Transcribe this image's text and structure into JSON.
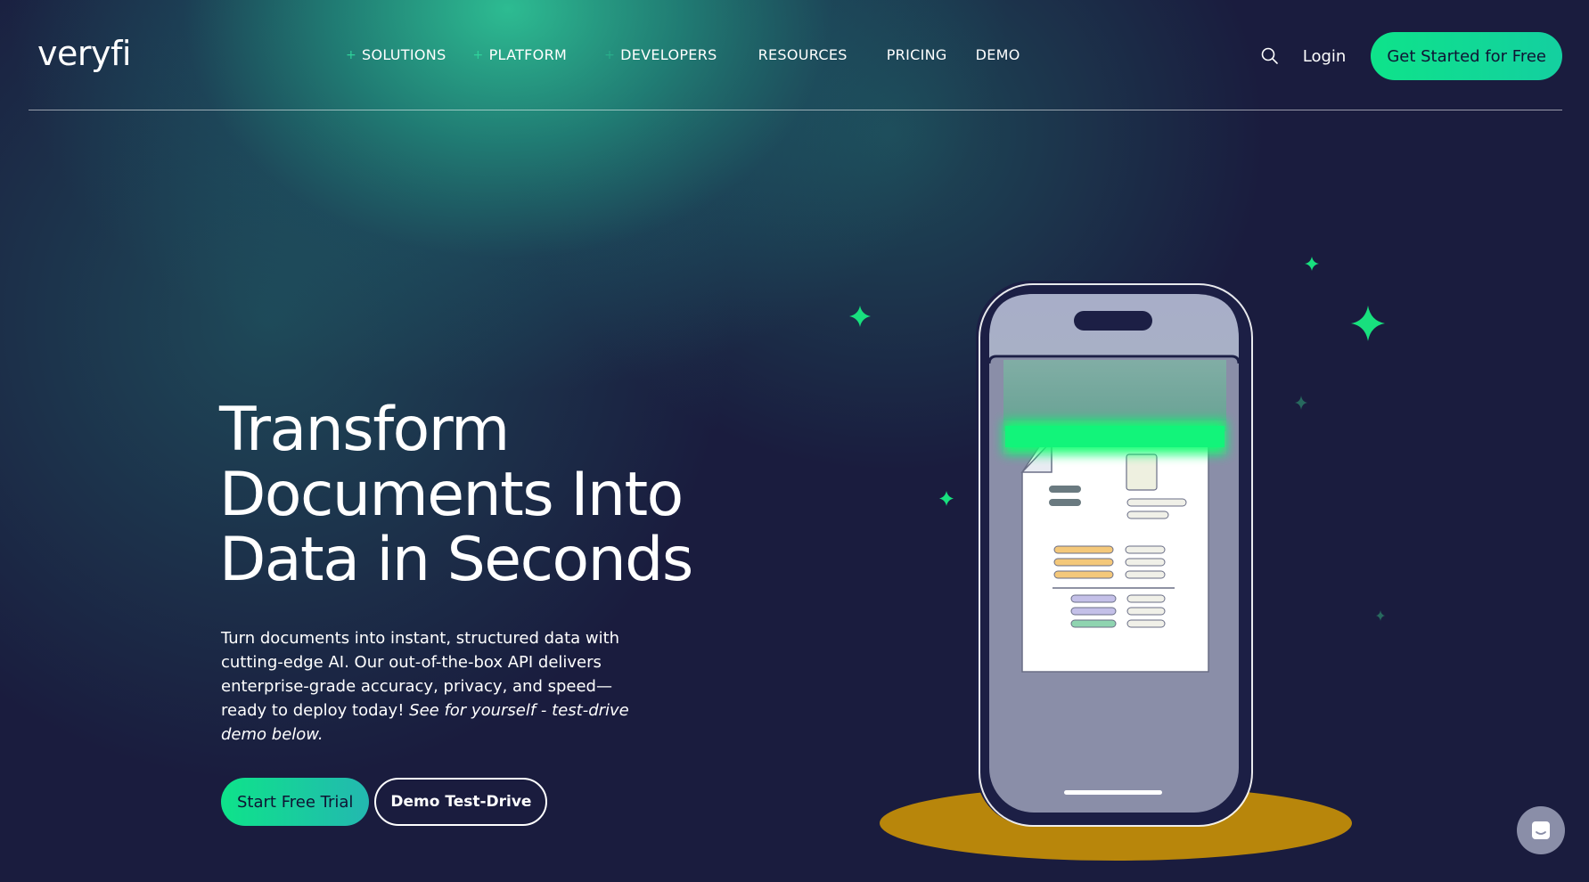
{
  "header": {
    "logo": "veryfi",
    "nav": [
      {
        "label": "SOLUTIONS",
        "has_plus": true
      },
      {
        "label": "PLATFORM",
        "has_plus": true
      },
      {
        "label": "DEVELOPERS",
        "has_plus": true
      },
      {
        "label": "RESOURCES",
        "has_plus": false
      },
      {
        "label": "PRICING",
        "has_plus": false
      },
      {
        "label": "DEMO",
        "has_plus": false
      }
    ],
    "login_label": "Login",
    "cta_label": "Get Started for Free",
    "search_icon": "search-icon"
  },
  "hero": {
    "title_lines": [
      "Transform",
      "Documents Into",
      "Data in Seconds"
    ],
    "description": "Turn documents into instant, structured data with cutting-edge AI. Our out-of-the-box API delivers enterprise-grade accuracy, privacy, and speed—ready to deploy today!",
    "description_emphasis": "See for yourself - test-drive demo below.",
    "primary_button": "Start Free Trial",
    "secondary_button": "Demo Test-Drive"
  },
  "icons": {
    "sparkle": "sparkle-icon",
    "chat": "chat-icon"
  },
  "colors": {
    "background": "#1a1c3e",
    "accent_green": "#0ee38a",
    "teal_glow": "#2ec496",
    "phone_frame": "#1c1f45",
    "phone_screen": "#8a8ea8",
    "platform_gold": "#b8860b",
    "chat_bubble": "#8a8ea8"
  }
}
